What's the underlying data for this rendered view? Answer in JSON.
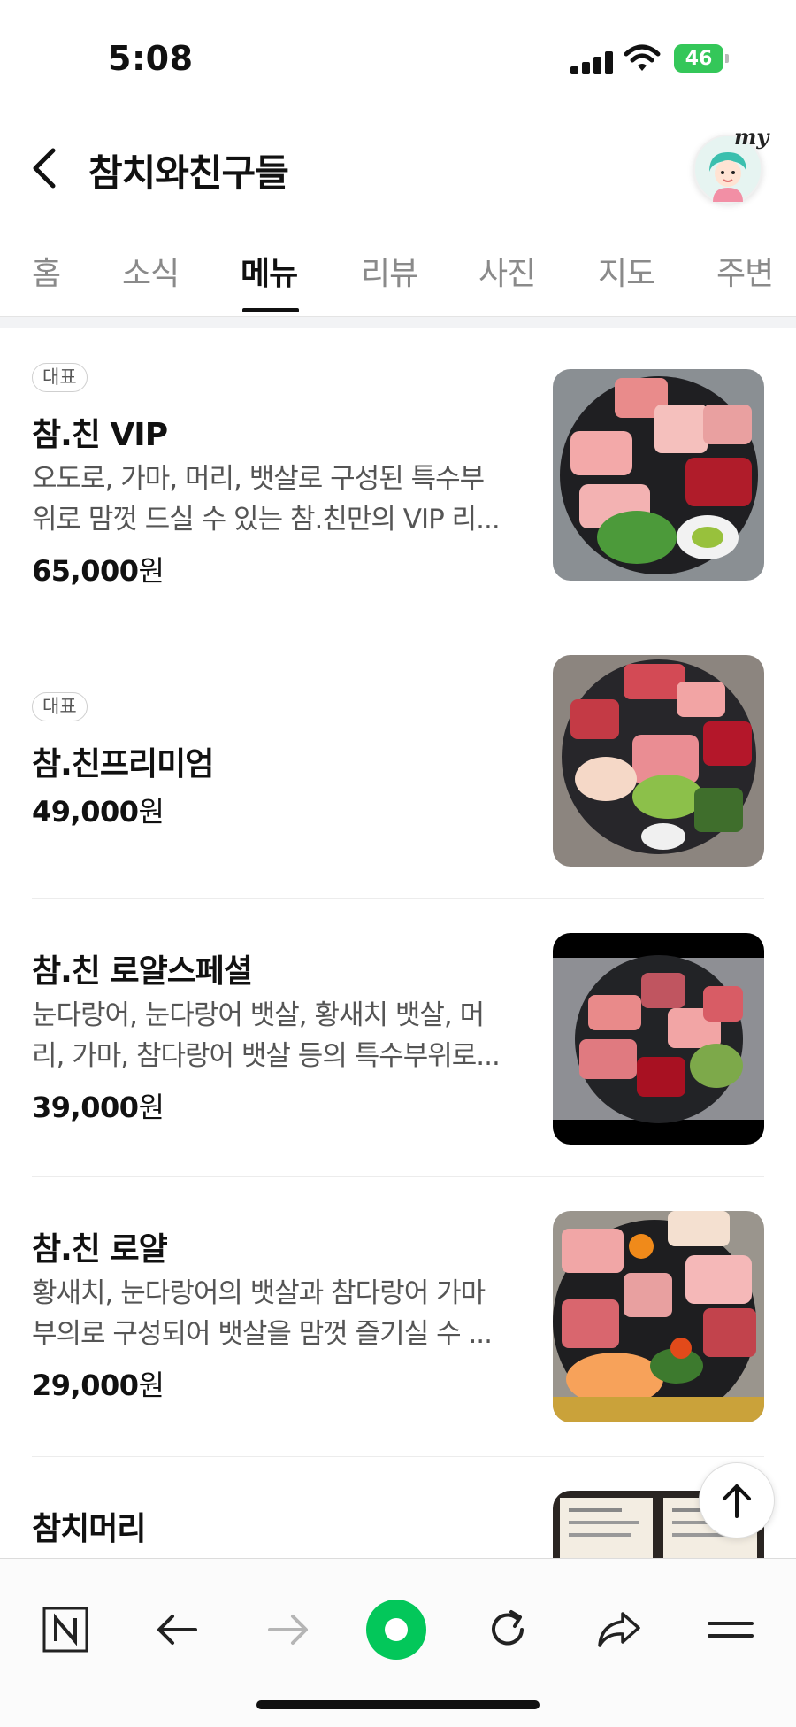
{
  "status": {
    "time": "5:08",
    "battery": "46"
  },
  "header": {
    "title": "참치와친구들",
    "my_label": "my"
  },
  "tabs": [
    {
      "label": "홈"
    },
    {
      "label": "소식"
    },
    {
      "label": "메뉴"
    },
    {
      "label": "리뷰"
    },
    {
      "label": "사진"
    },
    {
      "label": "지도"
    },
    {
      "label": "주변"
    }
  ],
  "active_tab": "메뉴",
  "menu": {
    "items": [
      {
        "badge": "대표",
        "name": "참.친 VIP",
        "desc_line1": "오도로, 가마, 머리, 뱃살로 구성된 특수부",
        "desc_line2": "위로 맘껏 드실 수 있는 참.친만의 VIP 리...",
        "price": "65,000",
        "currency": "원"
      },
      {
        "badge": "대표",
        "name": "참.친프리미엄",
        "price": "49,000",
        "currency": "원"
      },
      {
        "name": "참.친 로얄스페셜",
        "desc_line1": "눈다랑어, 눈다랑어 뱃살, 황새치 뱃살, 머",
        "desc_line2": "리, 가마, 참다랑어 뱃살 등의 특수부위로...",
        "price": "39,000",
        "currency": "원"
      },
      {
        "name": "참.친 로얄",
        "desc_line1": "황새치, 눈다랑어의 뱃살과 참다랑어 가마",
        "desc_line2": "부의로 구성되어 뱃살을 맘껏 즐기실 수 ...",
        "price": "29,000",
        "currency": "원"
      },
      {
        "name": "참치머리"
      }
    ]
  },
  "colors": {
    "accent_green": "#03c75a",
    "battery_green": "#34c759"
  },
  "toolbar_icons": [
    "naver-n-icon",
    "back-arrow-icon",
    "forward-arrow-icon",
    "green-dot-home-icon",
    "reload-icon",
    "share-icon",
    "menu-icon"
  ]
}
